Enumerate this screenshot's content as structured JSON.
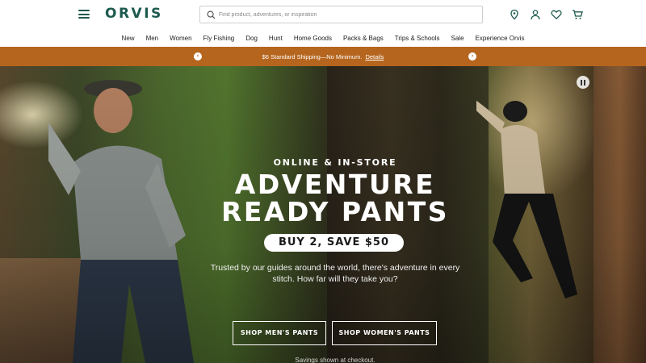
{
  "header": {
    "logo": "ORVIS",
    "search_placeholder": "Find product, adventures, or inspiration",
    "icons": [
      "menu-icon",
      "search-icon",
      "location-pin-icon",
      "account-icon",
      "heart-icon",
      "cart-icon"
    ]
  },
  "nav": {
    "items": [
      "New",
      "Men",
      "Women",
      "Fly Fishing",
      "Dog",
      "Hunt",
      "Home Goods",
      "Packs & Bags",
      "Trips & Schools",
      "Sale",
      "Experience Orvis"
    ]
  },
  "promo": {
    "text": "$6 Standard Shipping—No Minimum.",
    "link": "Details",
    "color": "#b5651d"
  },
  "hero": {
    "eyebrow": "ONLINE & IN-STORE",
    "headline_line1": "ADVENTURE",
    "headline_line2": "READY PANTS",
    "offer": "BUY 2, SAVE $50",
    "description": "Trusted by our guides around the world, there's adventure in every stitch. How far will they take you?",
    "cta_men": "SHOP MEN'S PANTS",
    "cta_women": "SHOP WOMEN'S PANTS",
    "fine_print": "Savings shown at checkout."
  },
  "brand_color": "#1d5a4e"
}
